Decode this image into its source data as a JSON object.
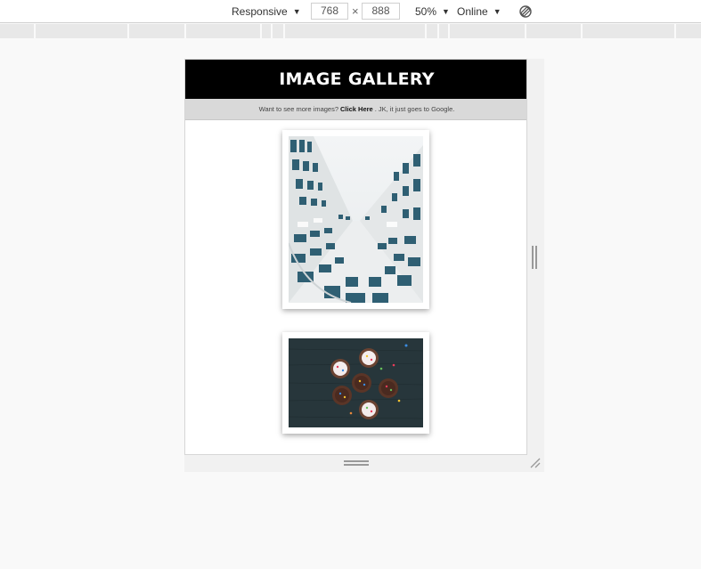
{
  "toolbar": {
    "device": "Responsive",
    "width": "768",
    "times": "×",
    "height": "888",
    "zoom": "50%",
    "throttle": "Online",
    "caret": "▼"
  },
  "page": {
    "title": "IMAGE GALLERY",
    "subtitle_prefix": "Want to see more images?",
    "subtitle_link": "Click Here",
    "subtitle_suffix": ". JK, it just goes to Google."
  },
  "gallery": {
    "items": [
      {
        "description": "building-upward-view"
      },
      {
        "description": "cupcakes-top-view"
      }
    ]
  },
  "colors": {
    "header_bg": "#000000",
    "subbar_bg": "#d9d9d9",
    "page_bg": "#f9f9f9"
  }
}
